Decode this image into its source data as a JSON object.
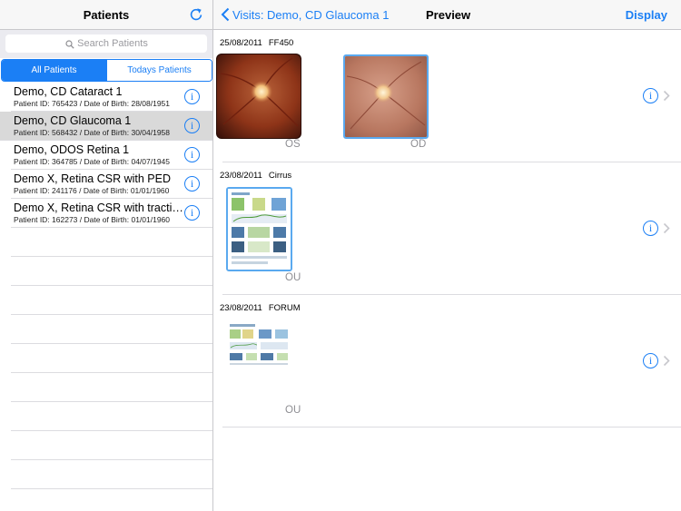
{
  "sidebar": {
    "title": "Patients",
    "search_placeholder": "Search Patients",
    "tabs": [
      "All Patients",
      "Todays Patients"
    ],
    "patients": [
      {
        "name": "Demo, CD Cataract 1",
        "meta": "Patient ID: 765423 / Date of Birth: 28/08/1951",
        "selected": false
      },
      {
        "name": "Demo, CD Glaucoma 1",
        "meta": "Patient ID: 568432 / Date of Birth: 30/04/1958",
        "selected": true
      },
      {
        "name": "Demo, ODOS Retina 1",
        "meta": "Patient ID: 364785 / Date of Birth: 04/07/1945",
        "selected": false
      },
      {
        "name": "Demo X, Retina CSR with PED",
        "meta": "Patient ID: 241176 / Date of Birth: 01/01/1960",
        "selected": false
      },
      {
        "name": "Demo X, Retina CSR with traction",
        "meta": "Patient ID: 162273 / Date of Birth: 01/01/1960",
        "selected": false
      }
    ]
  },
  "header": {
    "back_label": "Visits: Demo, CD Glaucoma 1",
    "title": "Preview",
    "display_label": "Display"
  },
  "visits": [
    {
      "date": "25/08/2011",
      "device": "FF450",
      "images": [
        {
          "type": "fundus-photo",
          "laterality": "OS",
          "selected": false
        },
        {
          "type": "fundus-photo",
          "laterality": "OD",
          "selected": true
        }
      ]
    },
    {
      "date": "23/08/2011",
      "device": "Cirrus",
      "images": [
        {
          "type": "oct-report",
          "laterality": "OU",
          "selected": true
        }
      ]
    },
    {
      "date": "23/08/2011",
      "device": "FORUM",
      "images": [
        {
          "type": "forum-report",
          "laterality": "OU",
          "selected": false
        }
      ]
    }
  ],
  "colors": {
    "accent": "#1b7ff5",
    "selected_row": "#d9d9d9"
  }
}
